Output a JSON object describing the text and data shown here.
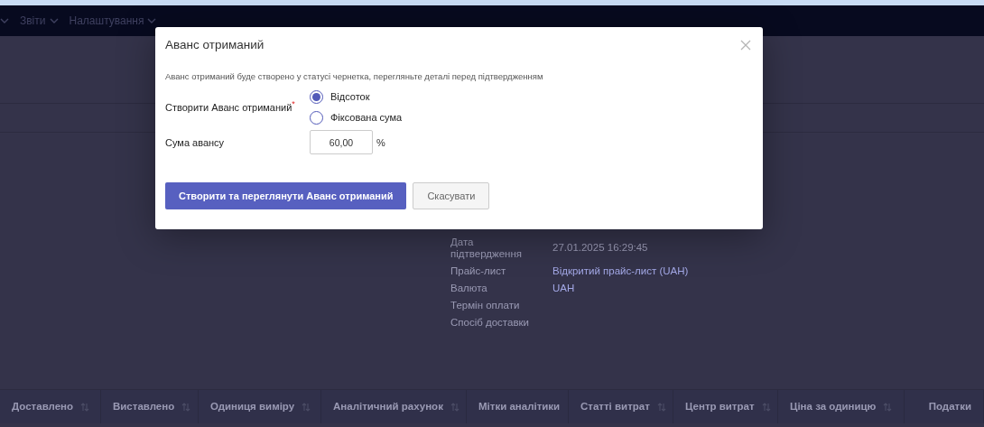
{
  "nav": {
    "items": [
      {
        "label": "Звіти"
      },
      {
        "label": "Налаштування"
      }
    ]
  },
  "details": [
    {
      "label": "Дата підтвердження",
      "value": "27.01.2025 16:29:45",
      "kind": "text"
    },
    {
      "label": "Прайс-лист",
      "value": "Відкритий прайс-лист (UAH)",
      "kind": "link"
    },
    {
      "label": "Валюта",
      "value": "UAH",
      "kind": "link"
    },
    {
      "label": "Термін оплати"
    },
    {
      "label": "Спосіб доставки"
    }
  ],
  "table": {
    "columns": [
      {
        "label": "Доставлено",
        "sortable": true
      },
      {
        "label": "Виставлено",
        "sortable": true
      },
      {
        "label": "Одиниця виміру",
        "sortable": true
      },
      {
        "label": "Аналітичний рахунок",
        "sortable": true
      },
      {
        "label": "Мітки аналітики",
        "sortable": false
      },
      {
        "label": "Статті витрат",
        "sortable": true
      },
      {
        "label": "Центр витрат",
        "sortable": true
      },
      {
        "label": "Ціна за одиницю",
        "sortable": true
      },
      {
        "label": "Податки",
        "sortable": false
      }
    ]
  },
  "dialog": {
    "title": "Аванс отриманий",
    "description": "Аванс отриманий буде створено у статусі чернетка, перегляньте деталі перед підтвердженням",
    "method_label": "Створити Аванс отриманий",
    "required_mark": "*",
    "options": [
      {
        "label": "Відсоток",
        "selected": true
      },
      {
        "label": "Фіксована сума",
        "selected": false
      }
    ],
    "amount_label": "Сума авансу",
    "amount_value": "60,00",
    "amount_unit": "%",
    "buttons": [
      {
        "label": "Створити та переглянути Аванс отриманий",
        "kind": "primary"
      },
      {
        "label": "Скасувати",
        "kind": "secondary"
      }
    ]
  }
}
